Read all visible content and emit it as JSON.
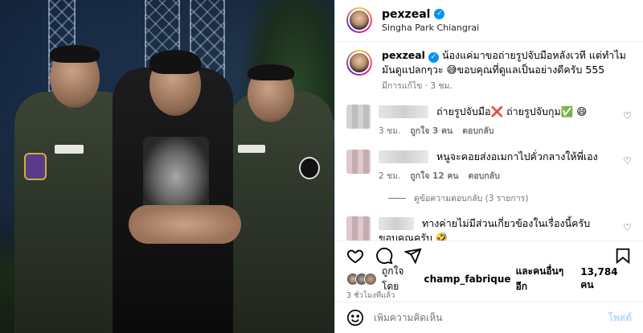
{
  "post": {
    "username": "pexzeal",
    "location": "Singha Park Chiangrai",
    "caption_text": "น้องแค่มาขอถ่ายรูปจับมือหลังเวที แต่ทำไมมันดูแปลกๆวะ 😅ขอบคุณที่ดูแลเป็นอย่างดีครับ 555",
    "edited_meta": "มีการแก้ไข · 3 ชม."
  },
  "comments": [
    {
      "text": "ถ่ายรูปจับมือ❌ ถ่ายรูปจับกุม✅ 😄",
      "time": "3 ชม.",
      "likes": "ถูกใจ 3 คน",
      "reply": "ตอบกลับ"
    },
    {
      "text": "หนูจะคอยส่งอเมกาไปคั่วกลางให้พี่เอง",
      "time": "2 ชม.",
      "likes": "ถูกใจ 12 คน",
      "reply": "ตอบกลับ",
      "view_replies": "ดูข้อความตอบกลับ (3 รายการ)"
    },
    {
      "text": "ทางค่ายไม่มีส่วนเกี่ยวข้องในเรื่องนี้ครับ ขอบคุณครับ 🤣"
    }
  ],
  "likes_line": {
    "prefix": "ถูกใจโดย",
    "user": "champ_fabrique",
    "middle": "และคนอื่นๆ อีก",
    "count": "13,784 คน"
  },
  "time_ago": "3 ชั่วโมงที่แล้ว",
  "composer": {
    "placeholder": "เพิ่มความคิดเห็น",
    "post_label": "โพสต์"
  },
  "icons": {
    "like": "heart-icon",
    "comment": "comment-icon",
    "share": "share-icon",
    "save": "bookmark-icon",
    "emoji": "emoji-icon",
    "verified": "verified-icon"
  },
  "colors": {
    "verified_blue": "#0095f6",
    "post_button_disabled": "#b3dbff",
    "meta_gray": "#737373"
  }
}
